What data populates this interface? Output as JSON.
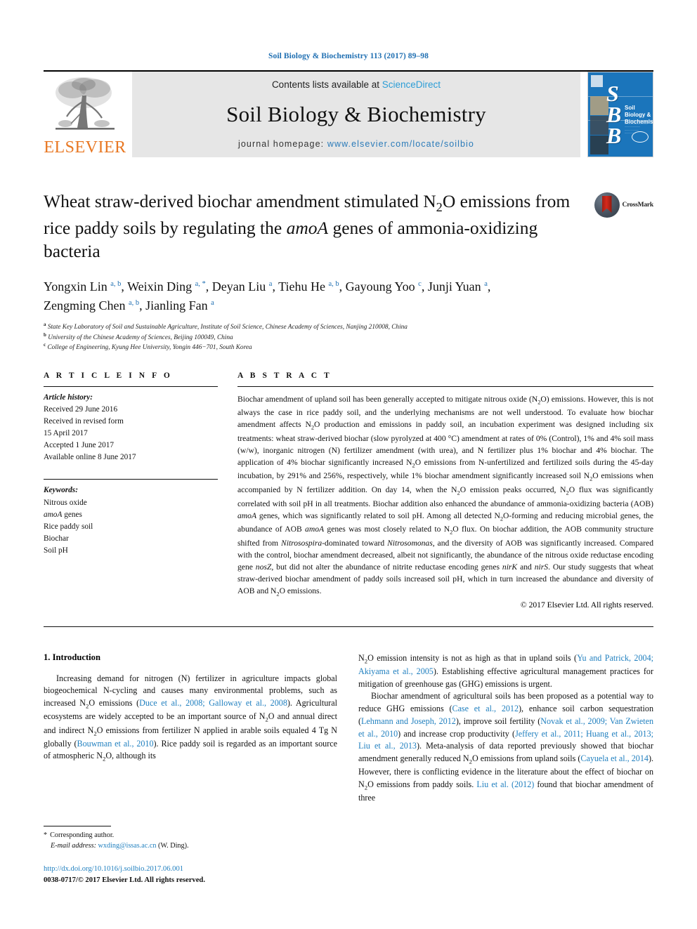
{
  "running_head": "Soil Biology & Biochemistry 113 (2017) 89–98",
  "masthead": {
    "publisher": "ELSEVIER",
    "contents_prefix": "Contents lists available at ",
    "contents_link": "ScienceDirect",
    "journal_title": "Soil Biology & Biochemistry",
    "homepage_prefix": "journal homepage: ",
    "homepage_url": "www.elsevier.com/locate/soilbio",
    "cover": {
      "letters": [
        "S",
        "B",
        "B"
      ],
      "cover_title": "Soil Biology & Biochemistry"
    },
    "link_color": "#2b9dd6"
  },
  "article": {
    "title_line1": "Wheat straw-derived biochar amendment stimulated N",
    "title_line1_sub": "2",
    "title_line1_end": "O emissions",
    "title_line2_a": "from rice paddy soils by regulating the ",
    "title_line2_italic": "amoA",
    "title_line2_b": " genes of",
    "title_line3": "ammonia-oxidizing bacteria",
    "crossmark_label": "CrossMark",
    "authors": [
      {
        "name": "Yongxin Lin",
        "sup": "a, b"
      },
      {
        "name": "Weixin Ding",
        "sup": "a, *"
      },
      {
        "name": "Deyan Liu",
        "sup": "a"
      },
      {
        "name": "Tiehu He",
        "sup": "a, b"
      },
      {
        "name": "Gayoung Yoo",
        "sup": "c"
      },
      {
        "name": "Junji Yuan",
        "sup": "a"
      },
      {
        "name": "Zengming Chen",
        "sup": "a, b"
      },
      {
        "name": "Jianling Fan",
        "sup": "a"
      }
    ],
    "affiliations": [
      {
        "mark": "a",
        "text": "State Key Laboratory of Soil and Sustainable Agriculture, Institute of Soil Science, Chinese Academy of Sciences, Nanjing 210008, China"
      },
      {
        "mark": "b",
        "text": "University of the Chinese Academy of Sciences, Beijing 100049, China"
      },
      {
        "mark": "c",
        "text": "College of Engineering, Kyung Hee University, Yongin 446−701, South Korea"
      }
    ]
  },
  "article_info": {
    "heading": "A R T I C L E   I N F O",
    "history_label": "Article history:",
    "history": [
      "Received 29 June 2016",
      "Received in revised form",
      "15 April 2017",
      "Accepted 1 June 2017",
      "Available online 8 June 2017"
    ],
    "keywords_label": "Keywords:",
    "keywords": [
      {
        "text": "Nitrous oxide",
        "italic_prefix": ""
      },
      {
        "text": "genes",
        "italic_prefix": "amoA"
      },
      {
        "text": "Rice paddy soil",
        "italic_prefix": ""
      },
      {
        "text": "Biochar",
        "italic_prefix": ""
      },
      {
        "text": "Soil pH",
        "italic_prefix": ""
      }
    ]
  },
  "abstract": {
    "heading": "A B S T R A C T",
    "copyright": "© 2017 Elsevier Ltd. All rights reserved."
  },
  "introduction": {
    "heading": "1.  Introduction"
  },
  "footnote": {
    "corresponding": "Corresponding author.",
    "email_label": "E-mail address:",
    "email": "wxding@issas.ac.cn",
    "email_owner": "(W. Ding)."
  },
  "footer": {
    "doi": "http://dx.doi.org/10.1016/j.soilbio.2017.06.001",
    "issn": "0038-0717/© 2017 Elsevier Ltd. All rights reserved."
  }
}
